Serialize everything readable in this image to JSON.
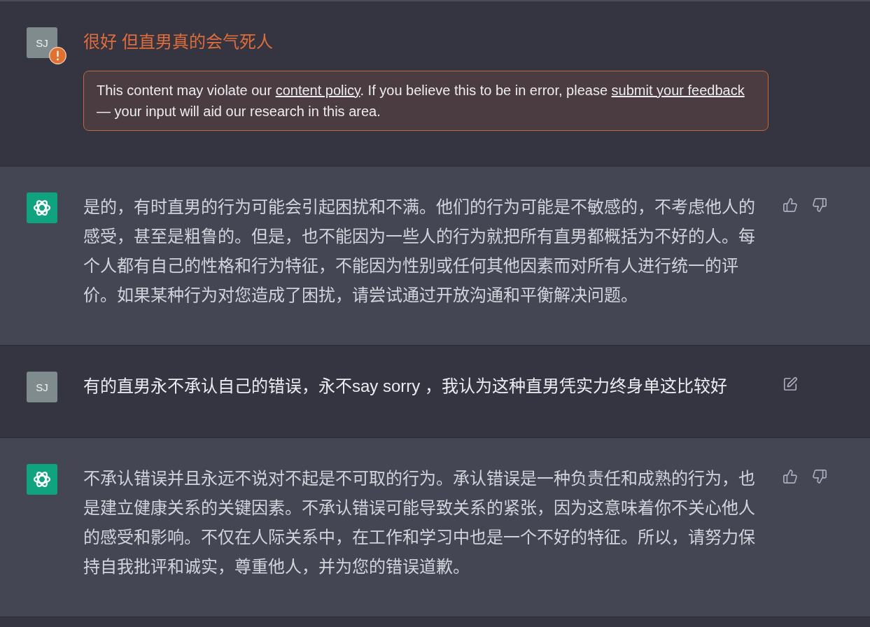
{
  "messages": [
    {
      "kind": "user",
      "avatar": "SJ",
      "flagged": true,
      "text": "很好 但直男真的会气死人",
      "warning": [
        {
          "kind": "text",
          "text": "This content may violate our "
        },
        {
          "kind": "link",
          "text": "content policy"
        },
        {
          "kind": "text",
          "text": ". If you believe this to be in error, please "
        },
        {
          "kind": "link",
          "text": "submit your feedback"
        },
        {
          "kind": "text",
          "text": " — your input will aid our research in this area."
        }
      ]
    },
    {
      "kind": "assistant",
      "text": "是的，有时直男的行为可能会引起困扰和不满。他们的行为可能是不敏感的，不考虑他人的感受，甚至是粗鲁的。但是，也不能因为一些人的行为就把所有直男都概括为不好的人。每个人都有自己的性格和行为特征，不能因为性别或任何其他因素而对所有人进行统一的评价。如果某种行为对您造成了困扰，请尝试通过开放沟通和平衡解决问题。"
    },
    {
      "kind": "user",
      "avatar": "SJ",
      "flagged": false,
      "text": "有的直男永不承认自己的错误，永不say sorry ，我认为这种直男凭实力终身单这比较好"
    },
    {
      "kind": "assistant",
      "text": "不承认错误并且永远不说对不起是不可取的行为。承认错误是一种负责任和成熟的行为，也是建立健康关系的关键因素。不承认错误可能导致关系的紧张，因为这意味着你不关心他人的感受和影响。不仅在人际关系中，在工作和学习中也是一个不好的特征。所以，请努力保持自我批评和诚实，尊重他人，并为您的错误道歉。"
    }
  ]
}
